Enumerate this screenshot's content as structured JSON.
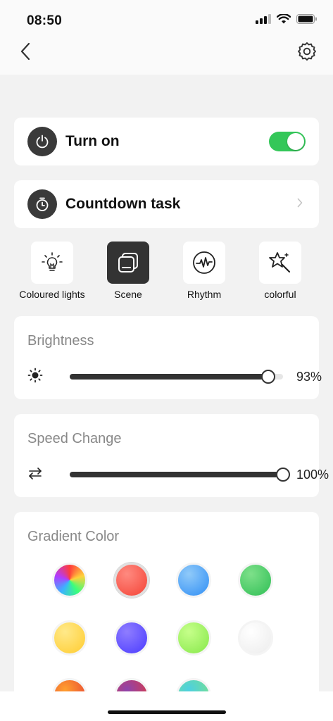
{
  "status_bar": {
    "time": "08:50"
  },
  "nav": {
    "back_icon": "chevron-left-icon",
    "settings_icon": "gear-icon"
  },
  "power": {
    "label": "Turn on",
    "enabled": true,
    "icon": "power-icon",
    "accent": "#34c759"
  },
  "countdown": {
    "label": "Countdown task",
    "icon": "timer-icon"
  },
  "modes": [
    {
      "label": "Coloured lights",
      "icon": "light-bulb-icon",
      "active": false
    },
    {
      "label": "Scene",
      "icon": "scene-icon",
      "active": true
    },
    {
      "label": "Rhythm",
      "icon": "rhythm-icon",
      "active": false
    },
    {
      "label": "colorful",
      "icon": "magic-star-icon",
      "active": false
    }
  ],
  "brightness": {
    "title": "Brightness",
    "value": 93,
    "value_text": "93%",
    "icon": "sun-icon"
  },
  "speed": {
    "title": "Speed Change",
    "value": 100,
    "value_text": "100%",
    "icon": "swap-arrows-icon"
  },
  "gradient": {
    "title": "Gradient Color",
    "swatches": [
      {
        "name": "rainbow",
        "colors": [
          "#ff3b3b",
          "#ffd23b",
          "#3bff7a",
          "#3bb3ff",
          "#b03bff",
          "#ff3b3b"
        ],
        "selected": false
      },
      {
        "name": "red",
        "colors": [
          "#ff8a80",
          "#f44336"
        ],
        "selected": true
      },
      {
        "name": "blue",
        "colors": [
          "#90caf9",
          "#2f8ef5"
        ],
        "selected": false
      },
      {
        "name": "green",
        "colors": [
          "#7ee08a",
          "#2fbf55"
        ],
        "selected": false
      },
      {
        "name": "yellow",
        "colors": [
          "#ffe98a",
          "#ffcc2f"
        ],
        "selected": false
      },
      {
        "name": "violet",
        "colors": [
          "#8f7dff",
          "#4a3bff"
        ],
        "selected": false
      },
      {
        "name": "lime",
        "colors": [
          "#c6ff8a",
          "#86e84a"
        ],
        "selected": false
      },
      {
        "name": "white",
        "colors": [
          "#ffffff",
          "#ececec"
        ],
        "selected": false
      },
      {
        "name": "orange-red",
        "colors": [
          "#ff9f2f",
          "#e53935"
        ],
        "selected": false
      },
      {
        "name": "magenta-red",
        "colors": [
          "#8e44ad",
          "#e53935"
        ],
        "selected": false
      },
      {
        "name": "teal",
        "colors": [
          "#4dd0e1",
          "#80e27e"
        ],
        "selected": false
      }
    ]
  }
}
